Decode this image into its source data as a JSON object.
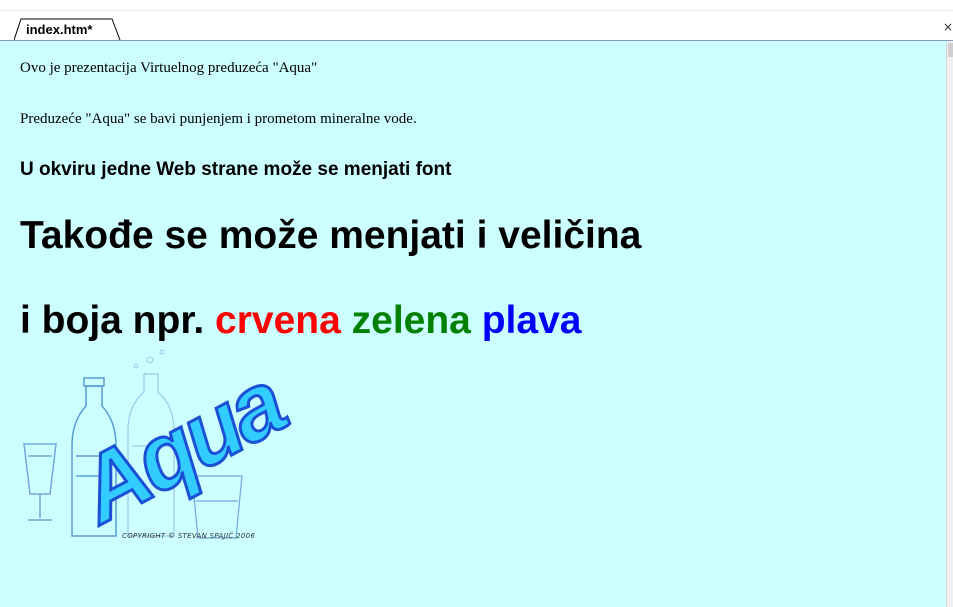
{
  "tab": {
    "label": "index.htm*",
    "close_glyph": "×"
  },
  "content": {
    "line1": "Ovo je prezentacija Virtuelnog preduzeća \"Aqua\"",
    "line2": "Preduzeće \"Aqua\" se bavi punjenjem i prometom mineralne vode.",
    "heading_small": "U okviru jedne Web strane može se menjati font",
    "heading_large": "Takođe se može menjati i veličina",
    "color_line": {
      "prefix": "i boja npr.",
      "red": "crvena",
      "green": "zelena",
      "blue": "plava"
    }
  },
  "logo": {
    "wordmark": "Aqua",
    "copyright": "COPYRIGHT © STEVAN SPAJIĆ 2006"
  },
  "colors": {
    "page_background": "#ccffff",
    "red": "#ff0000",
    "green": "#008000",
    "blue": "#0000ff",
    "logo_fill": "#33ccff",
    "logo_stroke": "#1a4fd6"
  }
}
